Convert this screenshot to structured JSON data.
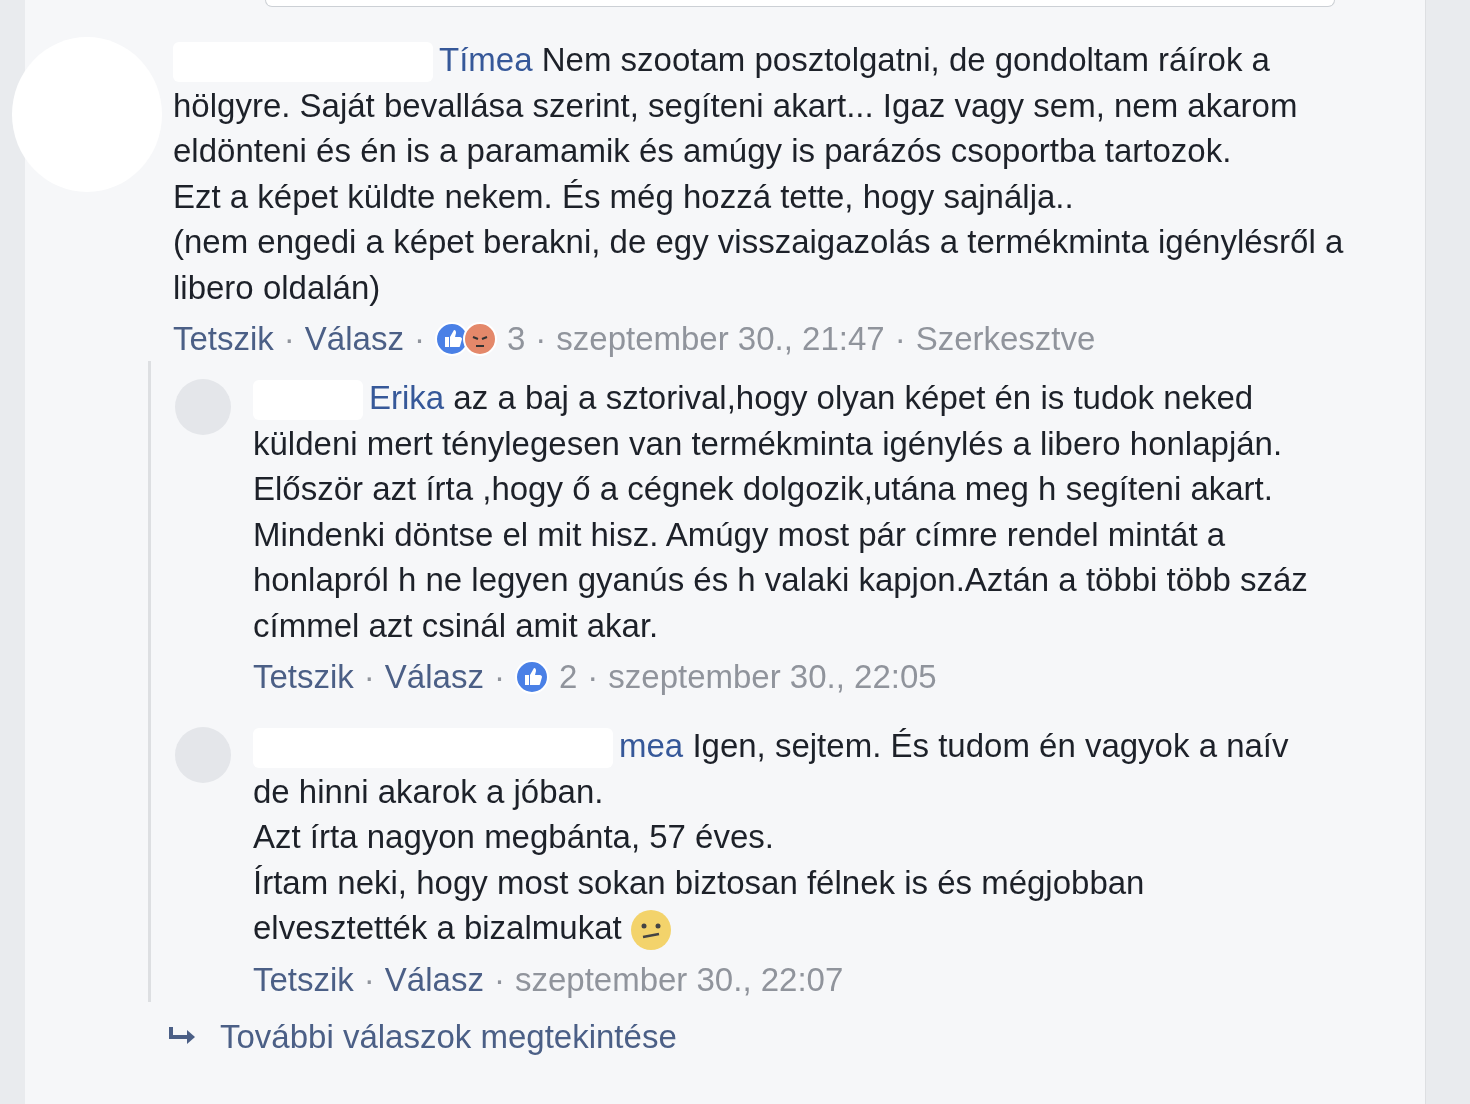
{
  "comment": {
    "author": "Tímea",
    "paragraphs": [
      "Nem szootam posztolgatni, de gondoltam ráírok a hölgyre. Saját bevallása szerint, segíteni akart... Igaz vagy sem, nem akarom eldönteni és én is a paramamik és amúgy is parázós csoportba tartozok.",
      "Ezt a képet küldte nekem. És még hozzá tette, hogy sajnálja..",
      "(nem engedi a képet berakni, de egy visszaigazolás a termékminta igénylésről a libero oldalán)"
    ],
    "meta": {
      "like": "Tetszik",
      "reply": "Válasz",
      "separator": "·",
      "reactions": [
        {
          "kind": "like"
        },
        {
          "kind": "angry"
        }
      ],
      "reaction_count": "3",
      "time": "szeptember 30., 21:47",
      "edited": "Szerkesztve"
    }
  },
  "replies": [
    {
      "author": "Erika",
      "paragraphs": [
        "az a baj a sztorival,hogy olyan képet én is tudok neked küldeni mert ténylegesen van termékminta igénylés a libero honlapján. Először azt írta ,hogy ő a cégnek dolgozik,utána meg h segíteni akart. Mindenki döntse el mit hisz. Amúgy most pár címre rendel mintát a honlapról h ne legyen gyanús és h valaki kapjon.Aztán a többi több száz címmel azt csinál amit akar."
      ],
      "meta": {
        "like": "Tetszik",
        "reply": "Válasz",
        "separator": "·",
        "reactions": [
          {
            "kind": "like"
          }
        ],
        "reaction_count": "2",
        "time": "szeptember 30., 22:05"
      }
    },
    {
      "author": "mea",
      "paragraphs": [
        "Igen, sejtem. És tudom én vagyok a naív de hinni akarok a jóban.",
        "Azt írta nagyon megbánta, 57 éves.",
        "Írtam neki, hogy most sokan biztosan félnek is és mégjobban elvesztették a bizalmukat"
      ],
      "emoji": {
        "kind": "confused"
      },
      "meta": {
        "like": "Tetszik",
        "reply": "Válasz",
        "separator": "·",
        "time": "szeptember 30., 22:07"
      }
    }
  ],
  "more_replies": "További válaszok megtekintése"
}
